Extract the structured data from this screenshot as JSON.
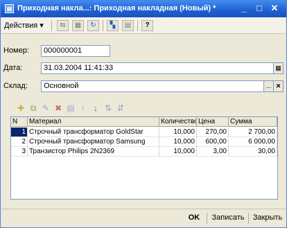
{
  "window": {
    "title": "Приходная накла...: Приходная накладная (Новый) *",
    "minimize_glyph": "_",
    "maximize_glyph": "□",
    "close_glyph": "✕"
  },
  "toolbar": {
    "actions_label": "Действия ▾",
    "help_glyph": "?"
  },
  "form": {
    "number_label": "Номер:",
    "number_value": "000000001",
    "date_label": "Дата:",
    "date_value": "31.03.2004 11:41:33",
    "warehouse_label": "Склад:",
    "warehouse_value": "Основной",
    "select_glyph": "...",
    "clear_glyph": "✕",
    "calendar_glyph": "▦"
  },
  "table": {
    "headers": [
      "N",
      "Материал",
      "Количество",
      "Цена",
      "Сумма"
    ],
    "rows": [
      {
        "n": "1",
        "material": "Строчный трансформатор GoldStar",
        "qty": "10,000",
        "price": "270,00",
        "sum": "2 700,00"
      },
      {
        "n": "2",
        "material": "Строчный трансформатор Samsung",
        "qty": "10,000",
        "price": "600,00",
        "sum": "6 000,00"
      },
      {
        "n": "3",
        "material": "Транзистор Philips 2N2369",
        "qty": "10,000",
        "price": "3,00",
        "sum": "30,00"
      }
    ]
  },
  "buttons": {
    "ok": "OK",
    "save": "Записать",
    "close": "Закрыть"
  },
  "colors": {
    "title_bar": "#1f5fd0",
    "selection": "#0a246a",
    "window_bg": "#ece9d8"
  }
}
